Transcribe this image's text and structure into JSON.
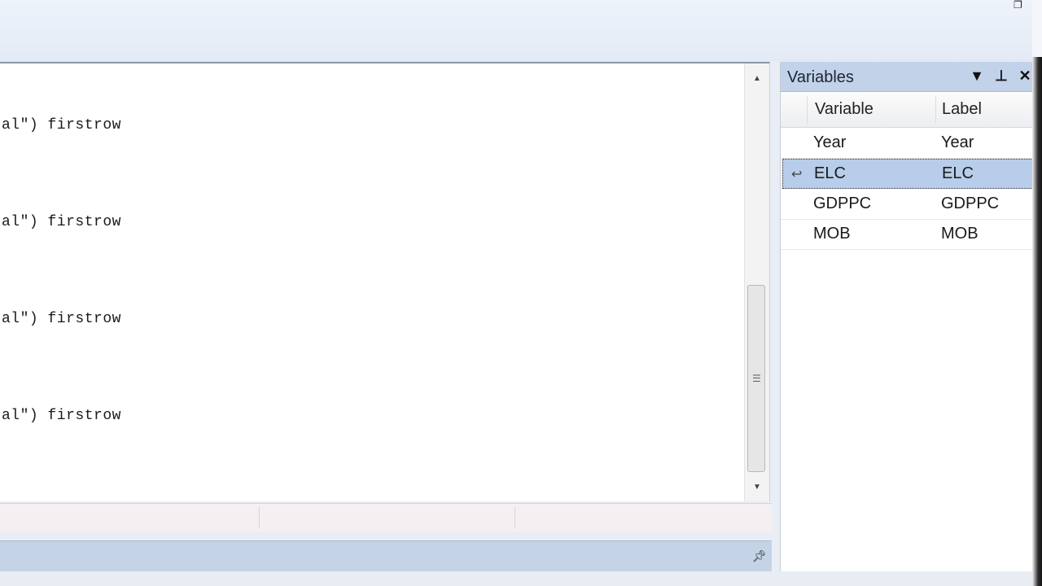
{
  "editor": {
    "lines": [
      "al\") firstrow",
      "al\") firstrow",
      "al\") firstrow",
      "al\") firstrow"
    ]
  },
  "variables_panel": {
    "title": "Variables",
    "columns": [
      "Variable",
      "Label"
    ],
    "rows": [
      {
        "variable": "Year",
        "label": "Year",
        "selected": false
      },
      {
        "variable": "ELC",
        "label": "ELC",
        "selected": true
      },
      {
        "variable": "GDPPC",
        "label": "GDPPC",
        "selected": false
      },
      {
        "variable": "MOB",
        "label": "MOB",
        "selected": false
      }
    ],
    "icons": [
      "filter-icon",
      "pin-icon",
      "close-icon"
    ]
  },
  "scrollbar": {
    "up_arrow": "▲",
    "down_arrow": "▼",
    "grip": "☰"
  },
  "colors": {
    "panel_header": "#c2d2e8",
    "selected_row": "#b8cde9",
    "bottom_panel": "#c4d3e6"
  }
}
